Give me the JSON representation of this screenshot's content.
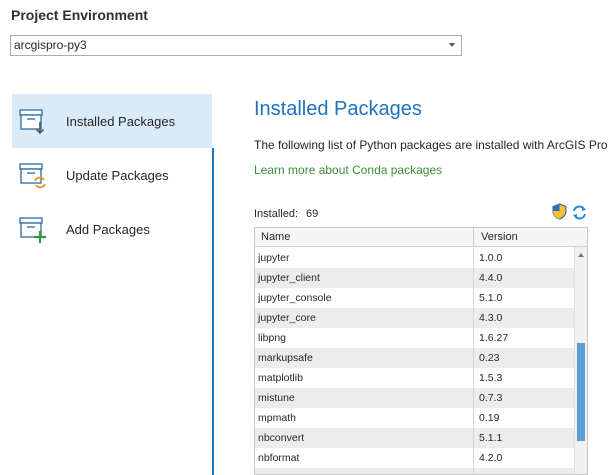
{
  "header": {
    "title": "Project Environment",
    "environment_value": "arcgispro-py3"
  },
  "sidebar": {
    "items": [
      {
        "label": "Installed Packages",
        "icon": "installed-packages-icon",
        "active": true
      },
      {
        "label": "Update Packages",
        "icon": "update-packages-icon",
        "active": false
      },
      {
        "label": "Add Packages",
        "icon": "add-packages-icon",
        "active": false
      }
    ]
  },
  "main": {
    "title": "Installed Packages",
    "description": "The following list of Python packages are installed with ArcGIS Pro.",
    "link": "Learn more about Conda packages",
    "installed_label": "Installed:",
    "installed_count": "69"
  },
  "table": {
    "columns": [
      "Name",
      "Version"
    ],
    "rows": [
      {
        "name": "jupyter",
        "version": "1.0.0"
      },
      {
        "name": "jupyter_client",
        "version": "4.4.0"
      },
      {
        "name": "jupyter_console",
        "version": "5.1.0"
      },
      {
        "name": "jupyter_core",
        "version": "4.3.0"
      },
      {
        "name": "libpng",
        "version": "1.6.27"
      },
      {
        "name": "markupsafe",
        "version": "0.23"
      },
      {
        "name": "matplotlib",
        "version": "1.5.3"
      },
      {
        "name": "mistune",
        "version": "0.7.3"
      },
      {
        "name": "mpmath",
        "version": "0.19"
      },
      {
        "name": "nbconvert",
        "version": "5.1.1"
      },
      {
        "name": "nbformat",
        "version": "4.2.0"
      },
      {
        "name": "",
        "version": ""
      }
    ]
  },
  "colors": {
    "accent": "#1e73be",
    "link": "#3a8f3a",
    "active_bg": "#d9ebf9",
    "scroll_thumb": "#5a9fd6"
  }
}
